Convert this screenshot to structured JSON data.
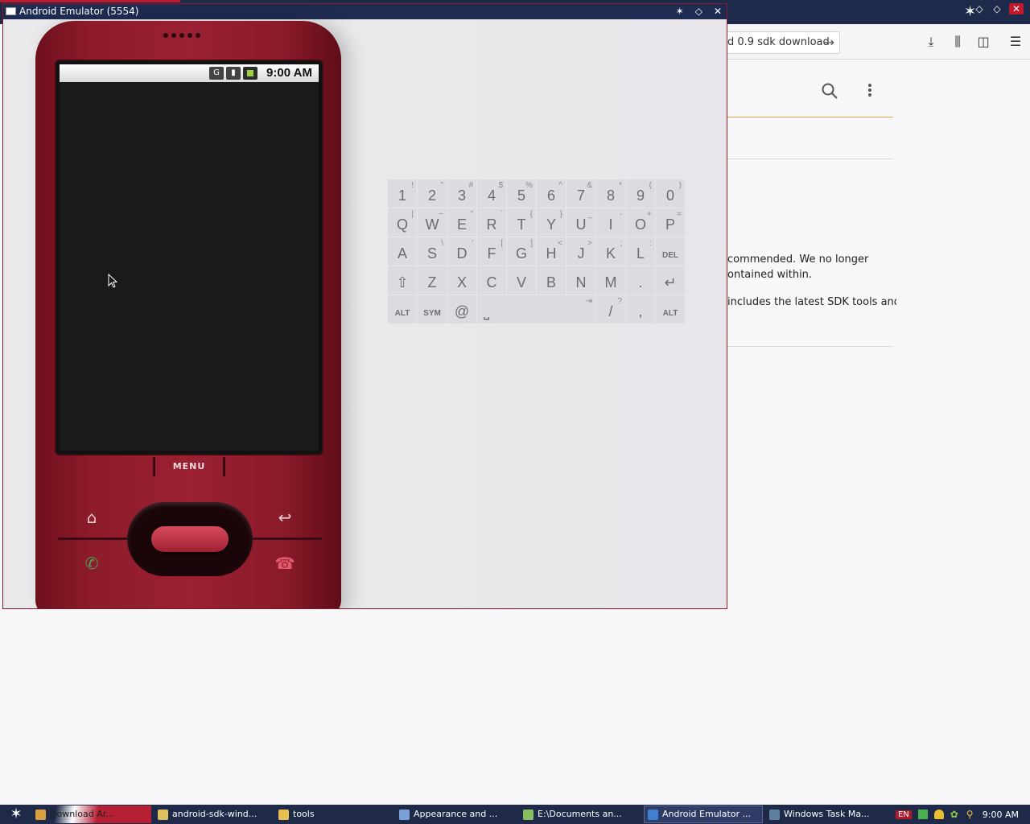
{
  "background_window": {
    "url_fragment": "d 0.9 sdk download",
    "page_lines": [
      "commended. We no longer",
      "ontained within.",
      "includes the latest SDK tools and"
    ]
  },
  "emulator": {
    "title": "Android Emulator (5554)",
    "status_time": "9:00 AM",
    "menu_label": "MENU"
  },
  "keyboard": {
    "rows": [
      [
        {
          "k": "1",
          "s": "!"
        },
        {
          "k": "2",
          "s": "\""
        },
        {
          "k": "3",
          "s": "#"
        },
        {
          "k": "4",
          "s": "$"
        },
        {
          "k": "5",
          "s": "%"
        },
        {
          "k": "6",
          "s": "^"
        },
        {
          "k": "7",
          "s": "&"
        },
        {
          "k": "8",
          "s": "*"
        },
        {
          "k": "9",
          "s": "("
        },
        {
          "k": "0",
          "s": ")"
        }
      ],
      [
        {
          "k": "Q",
          "s": "|"
        },
        {
          "k": "W",
          "s": "~"
        },
        {
          "k": "E",
          "s": "\""
        },
        {
          "k": "R",
          "s": "`"
        },
        {
          "k": "T",
          "s": "{"
        },
        {
          "k": "Y",
          "s": "}"
        },
        {
          "k": "U",
          "s": "_"
        },
        {
          "k": "I",
          "s": "-"
        },
        {
          "k": "O",
          "s": "+"
        },
        {
          "k": "P",
          "s": "="
        }
      ],
      [
        {
          "k": "A",
          "s": ""
        },
        {
          "k": "S",
          "s": "\\"
        },
        {
          "k": "D",
          "s": "'"
        },
        {
          "k": "F",
          "s": "["
        },
        {
          "k": "G",
          "s": "]"
        },
        {
          "k": "H",
          "s": "<"
        },
        {
          "k": "J",
          "s": ">"
        },
        {
          "k": "K",
          "s": ";"
        },
        {
          "k": "L",
          "s": ":"
        },
        {
          "k": "DEL",
          "s": ""
        }
      ],
      [
        {
          "k": "⇧",
          "s": ""
        },
        {
          "k": "Z",
          "s": ""
        },
        {
          "k": "X",
          "s": ""
        },
        {
          "k": "C",
          "s": ""
        },
        {
          "k": "V",
          "s": ""
        },
        {
          "k": "B",
          "s": ""
        },
        {
          "k": "N",
          "s": ""
        },
        {
          "k": "M",
          "s": ""
        },
        {
          "k": ".",
          "s": ""
        },
        {
          "k": "↵",
          "s": ""
        }
      ]
    ],
    "bottom": {
      "alt_left": "ALT",
      "sym": "SYM",
      "at": "@",
      "space_glyph": "⎵",
      "tab_glyph": "⇥",
      "slash": "/",
      "slash_sub": "?",
      "comma": ",",
      "alt_right": "ALT"
    }
  },
  "taskbar": {
    "items": [
      {
        "label": "Download Ar...",
        "color": "#d8a040"
      },
      {
        "label": "android-sdk-wind...",
        "color": "#e0c060"
      },
      {
        "label": "tools",
        "color": "#e8c050"
      },
      {
        "label": "Appearance and ...",
        "color": "#7aa0d8"
      },
      {
        "label": "E:\\Documents an...",
        "color": "#88c060"
      },
      {
        "label": "Android Emulator ...",
        "color": "#4080d0"
      },
      {
        "label": "Windows Task Ma...",
        "color": "#6080a0"
      }
    ],
    "language": "EN",
    "clock": "9:00 AM"
  }
}
